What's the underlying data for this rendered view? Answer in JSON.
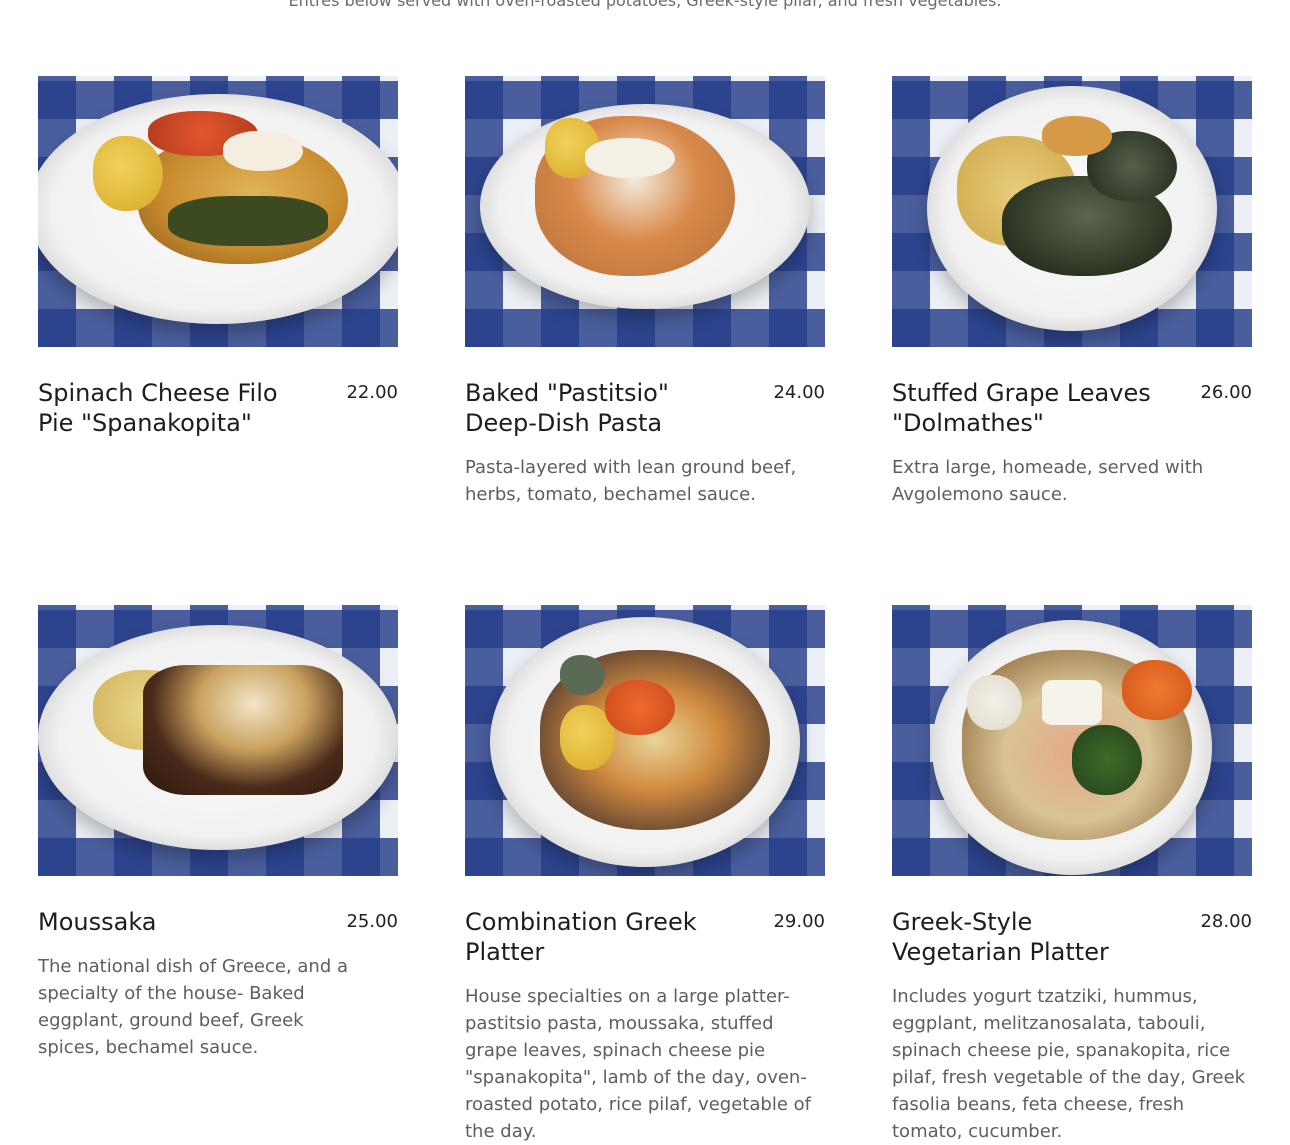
{
  "intro_text": "Entres below served with oven-roasted potatoes, Greek-style pilaf, and fresh vegetables.",
  "items": [
    {
      "name": "Spinach Cheese Filo Pie \"Spanakopita\"",
      "price": "22.00",
      "description": ""
    },
    {
      "name": "Baked \"Pastitsio\" Deep-Dish Pasta",
      "price": "24.00",
      "description": "Pasta-layered with lean ground beef, herbs, tomato, bechamel sauce."
    },
    {
      "name": "Stuffed Grape Leaves \"Dolmathes\"",
      "price": "26.00",
      "description": "Extra large, homeade, served with Avgolemono sauce."
    },
    {
      "name": "Moussaka",
      "price": "25.00",
      "description": "The national dish of Greece, and a specialty of the house- Baked eggplant, ground beef, Greek spices, bechamel sauce."
    },
    {
      "name": "Combination Greek Platter",
      "price": "29.00",
      "description": "House specialties on a large platter- pastitsio pasta, moussaka, stuffed grape leaves, spinach cheese pie \"spanakopita\", lamb of the day, oven-roasted potato, rice pilaf, vegetable of the day."
    },
    {
      "name": "Greek-Style Vegetarian Platter",
      "price": "28.00",
      "description": "Includes yogurt tzatziki, hummus, eggplant, melitzanosalata, tabouli, spinach cheese pie, spanakopita, rice pilaf, fresh vegetable of the day, Greek fasolia beans, feta cheese, fresh tomato, cucumber."
    }
  ]
}
